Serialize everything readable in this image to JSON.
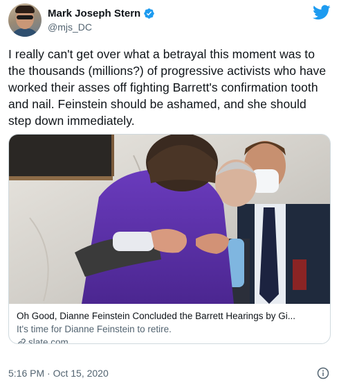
{
  "author": {
    "name": "Mark Joseph Stern",
    "handle": "@mjs_DC",
    "verified": true,
    "avatar_icon": "profile-photo"
  },
  "brand": {
    "icon": "twitter-bird-icon",
    "color": "#1d9bf0"
  },
  "tweet": {
    "text": "I really can't get over what a betrayal this moment was to the thousands (millions?) of progressive activists who have worked their asses off fighting Barrett's confirmation tooth and nail. Feinstein should be ashamed, and she should step down immediately."
  },
  "link_card": {
    "title": "Oh Good, Dianne Feinstein Concluded the Barrett Hearings by Gi...",
    "description": "It's time for Dianne Feinstein to retire.",
    "domain": "slate.com",
    "domain_icon": "link-icon",
    "image_description": "photo-embrace"
  },
  "footer": {
    "timestamp": "5:16 PM · Oct 15, 2020",
    "info_icon": "info-icon"
  },
  "colors": {
    "text": "#0f1419",
    "secondary": "#536471",
    "border": "#cfd9de",
    "verified_badge": "#1d9bf0",
    "suit_purple": "#5a2fa0"
  }
}
